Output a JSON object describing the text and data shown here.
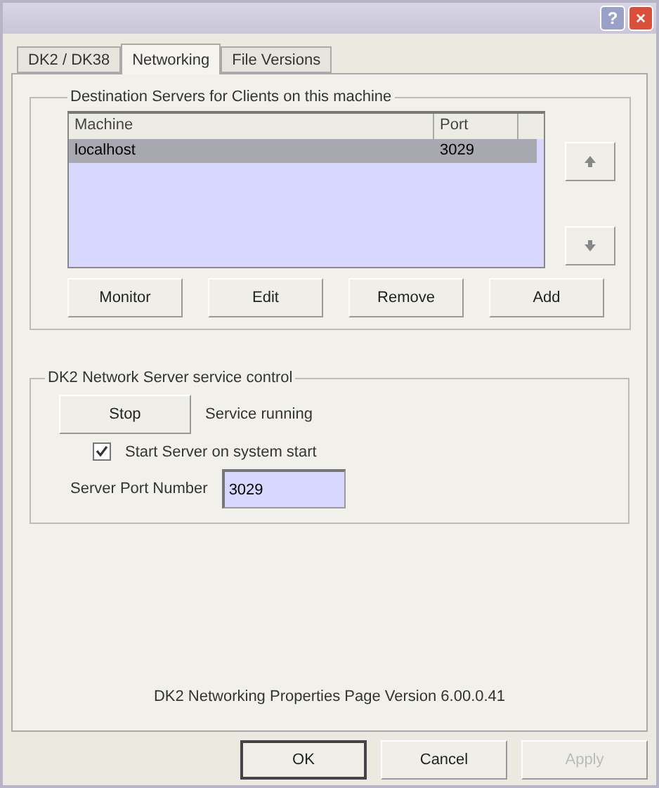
{
  "window": {
    "help": "?",
    "close": "×"
  },
  "tabs": [
    {
      "label": "DK2 / DK38",
      "selected": false
    },
    {
      "label": "Networking",
      "selected": true
    },
    {
      "label": "File Versions",
      "selected": false
    }
  ],
  "destinations": {
    "title": "Destination Servers for Clients on this machine",
    "columns": [
      "Machine",
      "Port"
    ],
    "rows": [
      {
        "machine": "localhost",
        "port": "3029",
        "selected": true
      }
    ],
    "buttons": [
      {
        "label": "Monitor",
        "disabled": false
      },
      {
        "label": "Edit",
        "disabled": false
      },
      {
        "label": "Remove",
        "disabled": false
      },
      {
        "label": "Add",
        "disabled": false
      }
    ]
  },
  "service": {
    "title": "DK2 Network Server service control",
    "button": "Stop",
    "status": "Service running",
    "start_on_boot": {
      "label": "Start Server on system start",
      "checked": true
    },
    "port_label": "Server Port Number",
    "port_value": "3029"
  },
  "version": "DK2 Networking Properties Page Version 6.00.0.41",
  "buttons": [
    {
      "label": "OK",
      "disabled": false,
      "default": true
    },
    {
      "label": "Cancel",
      "disabled": false,
      "default": false
    },
    {
      "label": "Apply",
      "disabled": true,
      "default": false
    }
  ]
}
